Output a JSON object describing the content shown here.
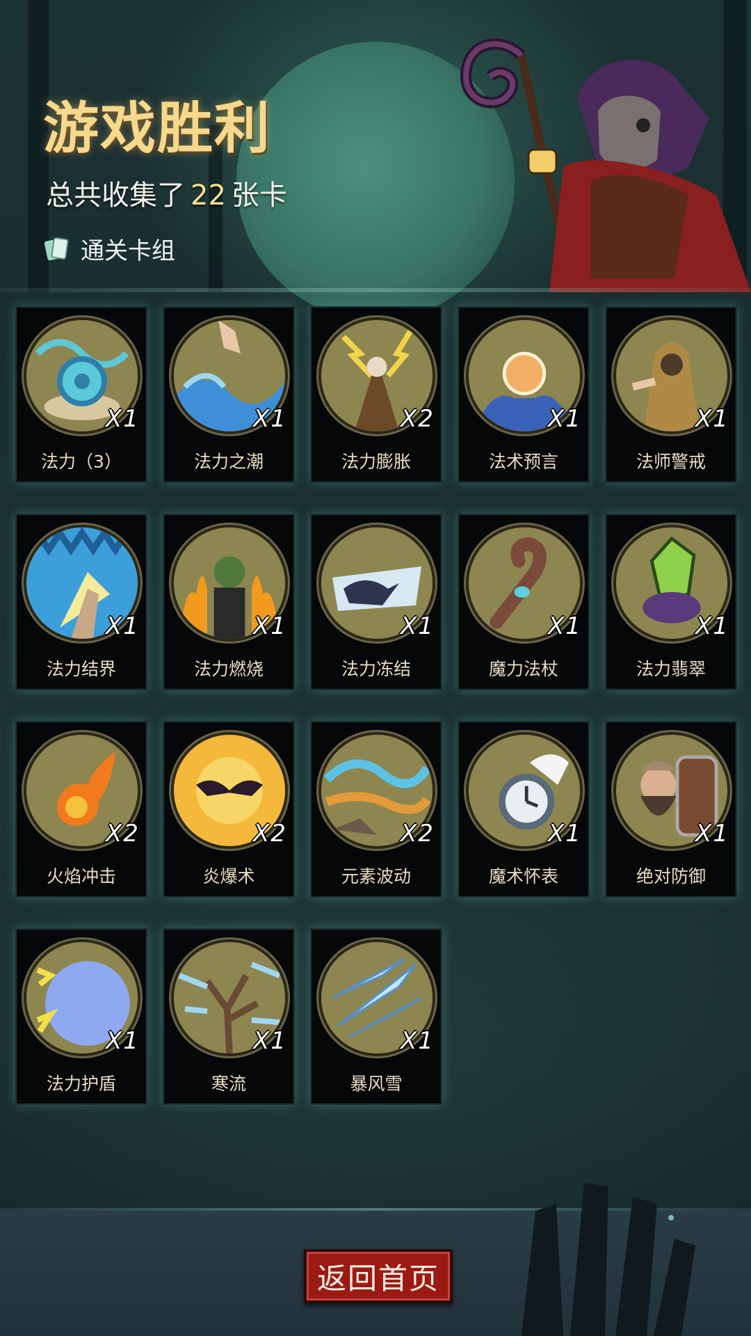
{
  "header": {
    "title": "游戏胜利",
    "summary_prefix": "总共收集了",
    "card_count": "22",
    "summary_suffix": "张卡",
    "deck_link": "通关卡组"
  },
  "cards": [
    {
      "name": "法力（3）",
      "qty": "X1",
      "icon": "mana-orb-icon",
      "palette": [
        "#8d8650",
        "#5cc9d8",
        "#2f7fa8"
      ]
    },
    {
      "name": "法力之潮",
      "qty": "X1",
      "icon": "water-wave-icon",
      "palette": [
        "#8d8650",
        "#3f8fd8",
        "#9fd7f2"
      ]
    },
    {
      "name": "法力膨胀",
      "qty": "X2",
      "icon": "lightning-wizard-icon",
      "palette": [
        "#8d8650",
        "#f1d44b",
        "#6b4a28"
      ]
    },
    {
      "name": "法术预言",
      "qty": "X1",
      "icon": "crystal-ball-icon",
      "palette": [
        "#8d8650",
        "#f2b066",
        "#3a63b8"
      ]
    },
    {
      "name": "法师警戒",
      "qty": "X1",
      "icon": "hooded-mage-icon",
      "palette": [
        "#8d8650",
        "#b08a45",
        "#4a3a2a"
      ]
    },
    {
      "name": "法力结界",
      "qty": "X1",
      "icon": "barrier-hand-icon",
      "palette": [
        "#3d9fd9",
        "#f2eb9a",
        "#1f5f96"
      ]
    },
    {
      "name": "法力燃烧",
      "qty": "X1",
      "icon": "burning-zombie-icon",
      "palette": [
        "#8d8650",
        "#f29a1c",
        "#4f7a3c"
      ]
    },
    {
      "name": "法力冻结",
      "qty": "X1",
      "icon": "frozen-hand-icon",
      "palette": [
        "#8d8650",
        "#d6e8f2",
        "#2e3452"
      ]
    },
    {
      "name": "魔力法杖",
      "qty": "X1",
      "icon": "magic-staff-icon",
      "palette": [
        "#8d8650",
        "#7a4a3a",
        "#5bd0e0"
      ]
    },
    {
      "name": "法力翡翠",
      "qty": "X1",
      "icon": "emerald-crystal-icon",
      "palette": [
        "#8d8650",
        "#8fd14a",
        "#5a3a7a"
      ]
    },
    {
      "name": "火焰冲击",
      "qty": "X2",
      "icon": "fireball-icon",
      "palette": [
        "#8d8650",
        "#f07a1c",
        "#f4c23c"
      ]
    },
    {
      "name": "炎爆术",
      "qty": "X2",
      "icon": "fire-bat-icon",
      "palette": [
        "#f4b93a",
        "#2a1a2a",
        "#f7d667"
      ]
    },
    {
      "name": "元素波动",
      "qty": "X2",
      "icon": "elemental-wave-icon",
      "palette": [
        "#8d8650",
        "#5cc3e6",
        "#e39a3a"
      ]
    },
    {
      "name": "魔术怀表",
      "qty": "X1",
      "icon": "pocket-watch-icon",
      "palette": [
        "#8d8650",
        "#e8eef2",
        "#5a6a7a"
      ]
    },
    {
      "name": "绝对防御",
      "qty": "X1",
      "icon": "dwarf-shield-icon",
      "palette": [
        "#8d8650",
        "#a08a70",
        "#4a3a30"
      ]
    },
    {
      "name": "法力护盾",
      "qty": "X1",
      "icon": "mana-shield-icon",
      "palette": [
        "#8d8650",
        "#8fa8f2",
        "#f2e04a"
      ]
    },
    {
      "name": "寒流",
      "qty": "X1",
      "icon": "frost-tree-icon",
      "palette": [
        "#8d8650",
        "#9fd7f2",
        "#6a4a34"
      ]
    },
    {
      "name": "暴风雪",
      "qty": "X1",
      "icon": "ice-shards-icon",
      "palette": [
        "#8d8650",
        "#bfe6f6",
        "#5a8fc4"
      ]
    }
  ],
  "footer": {
    "home_button": "返回首页"
  },
  "colors": {
    "title": "#f6d98c",
    "count": "#f7df92",
    "button": "#9c1a14",
    "card_bg": "#050708",
    "card_glow": "#6ec8b4"
  }
}
